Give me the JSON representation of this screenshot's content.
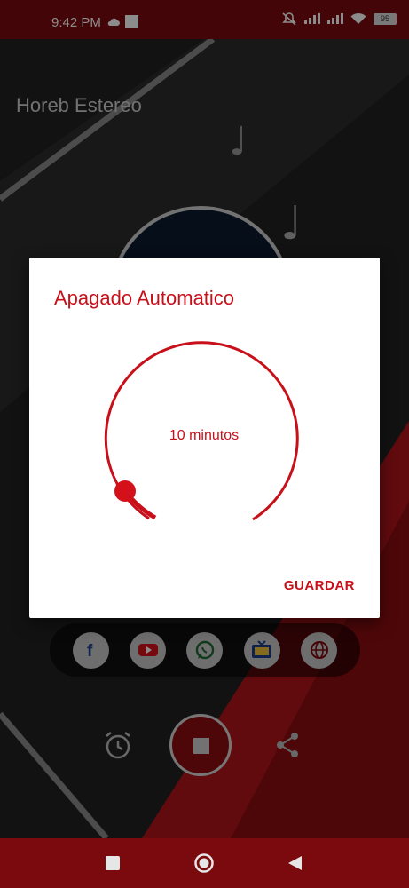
{
  "status_bar": {
    "time": "9:42 PM",
    "battery": "95",
    "icons": [
      "cloud-icon",
      "notification-square-icon",
      "mute-icon",
      "signal-icon",
      "signal-icon",
      "wifi-icon",
      "battery-icon"
    ]
  },
  "app": {
    "title": "Horeb Estereo"
  },
  "dialog": {
    "title": "Apagado Automatico",
    "value_text": "10 minutos",
    "save_label": "GUARDAR"
  },
  "social": {
    "icons": [
      "facebook-icon",
      "youtube-icon",
      "whatsapp-icon",
      "tv-icon",
      "globe-icon"
    ]
  },
  "controls": {
    "icons": [
      "alarm-clock-icon",
      "play-pause-icon",
      "share-icon"
    ]
  },
  "nav": {
    "icons": [
      "recents-icon",
      "home-icon",
      "back-icon"
    ]
  },
  "colors": {
    "accent": "#c8101a",
    "status_bar": "#7a0a0d",
    "dialog_bg": "#ffffff"
  }
}
